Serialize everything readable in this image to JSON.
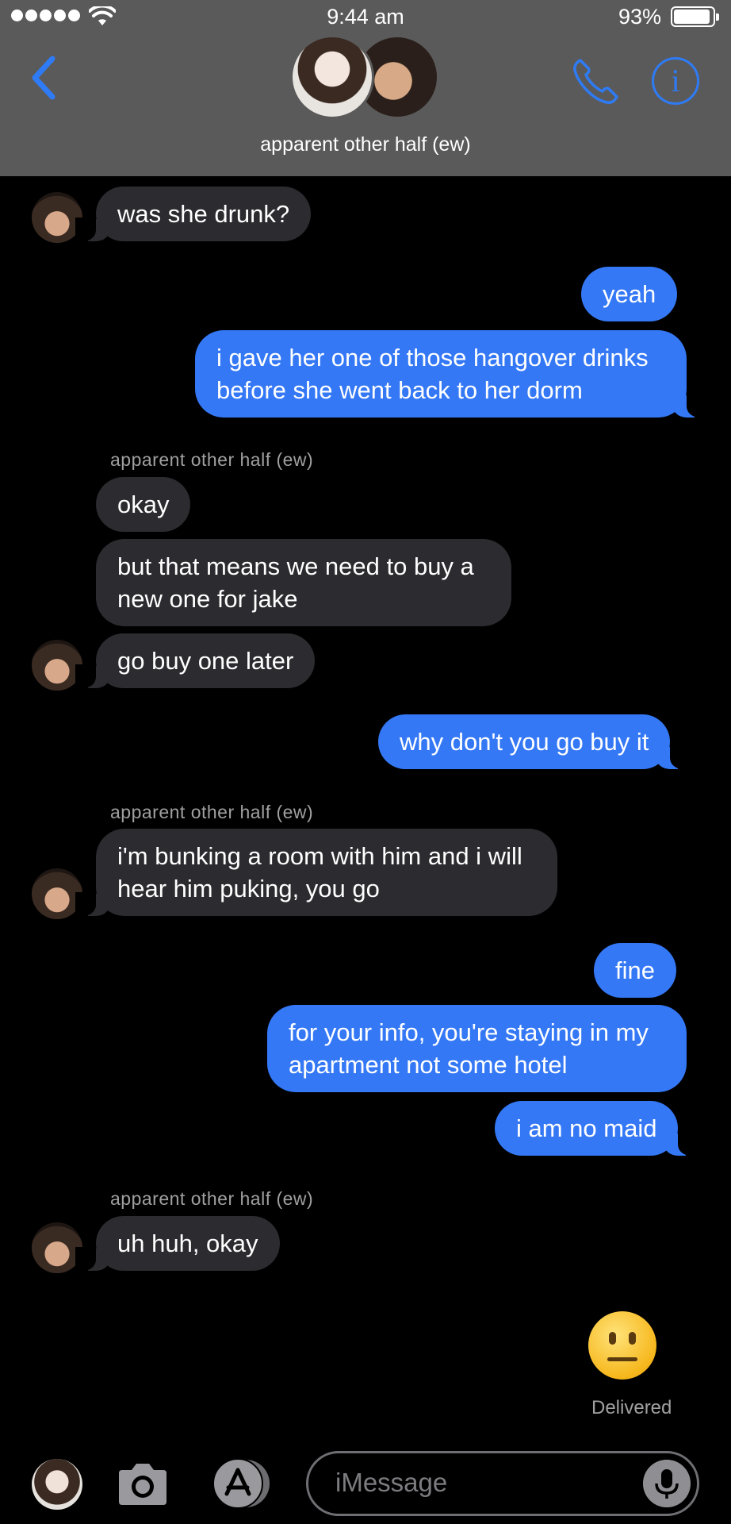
{
  "status_bar": {
    "time": "9:44 am",
    "battery": "93%"
  },
  "header": {
    "contact_name": "apparent other half (ew)"
  },
  "messages": [
    {
      "from": "them",
      "text": "was she drunk?"
    },
    {
      "from": "me",
      "text": "yeah"
    },
    {
      "from": "me",
      "lines": [
        "i gave her one of those hangover drinks",
        "before she went back to her dorm"
      ]
    },
    {
      "sender": "apparent other half (ew)"
    },
    {
      "from": "them",
      "text": "okay"
    },
    {
      "from": "them",
      "lines": [
        "but that means we need to buy a",
        "new one for jake"
      ]
    },
    {
      "from": "them",
      "text": "go buy one later"
    },
    {
      "from": "me",
      "text": "why don't you go buy it"
    },
    {
      "sender": "apparent other half (ew)"
    },
    {
      "from": "them",
      "lines": [
        "i'm bunking a room with him and i will",
        "hear him puking, you go"
      ]
    },
    {
      "from": "me",
      "text": "fine"
    },
    {
      "from": "me",
      "lines": [
        "for your info, you're staying in my",
        "apartment not some hotel"
      ]
    },
    {
      "from": "me",
      "text": "i am no maid"
    },
    {
      "sender": "apparent other half (ew)"
    },
    {
      "from": "them",
      "text": "uh huh, okay"
    },
    {
      "from": "me",
      "emoji": "neutral-face"
    }
  ],
  "delivered_label": "Delivered",
  "input": {
    "placeholder": "iMessage"
  },
  "colors": {
    "header_bg": "#5a5a5a",
    "accent_blue": "#3478f6",
    "incoming_bubble": "#2b2b30",
    "background": "#000000"
  }
}
